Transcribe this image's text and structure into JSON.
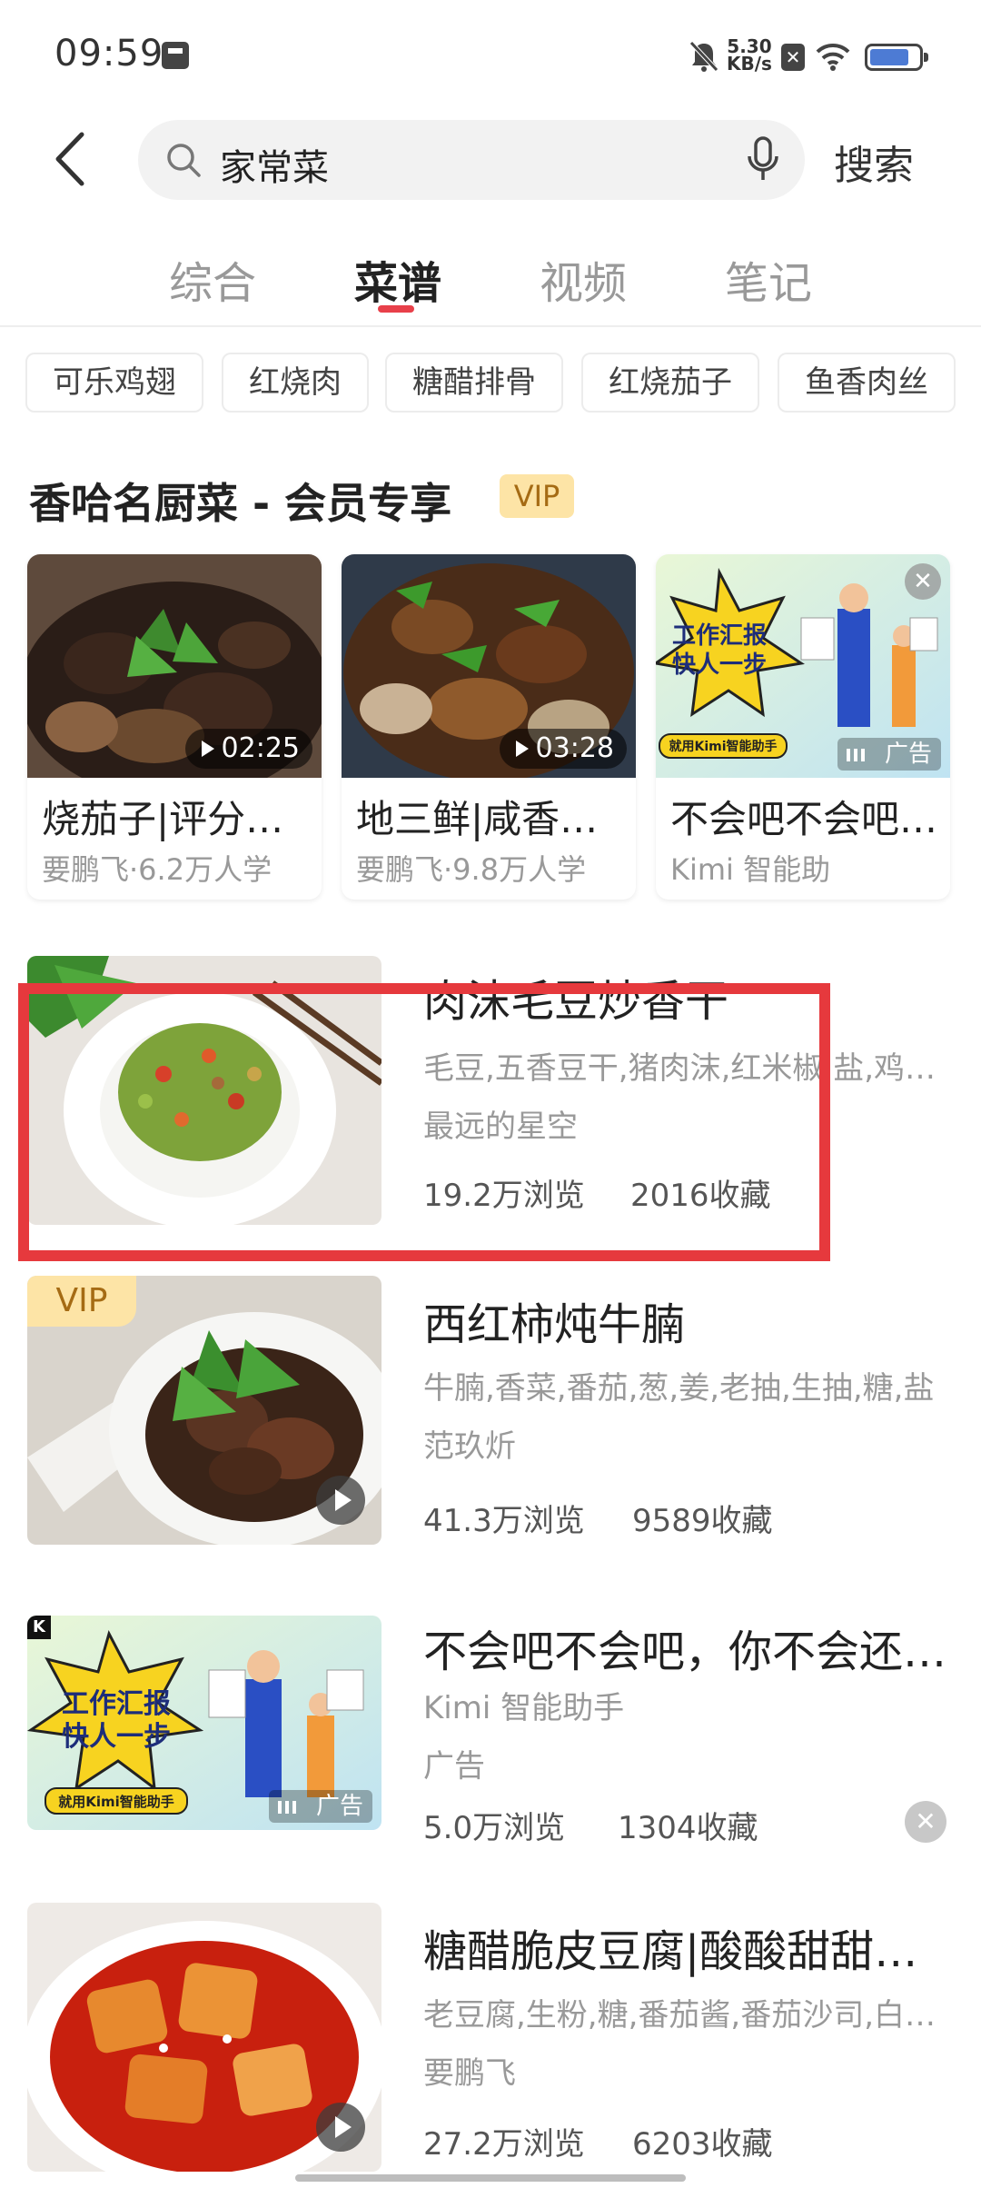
{
  "status_bar": {
    "time": "09:59",
    "net_speed_value": "5.30",
    "net_speed_unit": "KB/s"
  },
  "search": {
    "query": "家常菜",
    "button_label": "搜索"
  },
  "tabs": [
    {
      "label": "综合",
      "active": false
    },
    {
      "label": "菜谱",
      "active": true
    },
    {
      "label": "视频",
      "active": false
    },
    {
      "label": "笔记",
      "active": false
    }
  ],
  "chips": [
    "可乐鸡翅",
    "红烧肉",
    "糖醋排骨",
    "红烧茄子",
    "鱼香肉丝"
  ],
  "section": {
    "title": "香哈名厨菜 - 会员专享",
    "badge": "VIP"
  },
  "cards": [
    {
      "title": "烧茄子|评分最高的做法",
      "subtitle": "要鹏飞·6.2万人学",
      "duration": "02:25",
      "type": "video"
    },
    {
      "title": "地三鲜|咸香下饭",
      "subtitle": "要鹏飞·9.8万人学",
      "duration": "03:28",
      "type": "video"
    },
    {
      "title": "不会吧不会吧，你不会…",
      "subtitle": "Kimi 智能助",
      "ad_label": "广告",
      "ad_art_line1": "工作汇报",
      "ad_art_line2": "快人一步",
      "ad_art_line3": "就用Kimi智能助手",
      "type": "ad"
    }
  ],
  "recipes": [
    {
      "title": "肉沫毛豆炒香干",
      "ingredients": "毛豆,五香豆干,猪肉沫,红米椒,盐,鸡精,生抽",
      "author": "最远的星空",
      "views": "19.2万浏览",
      "favorites": "2016收藏",
      "vip": false,
      "video": false
    },
    {
      "title": "西红柿炖牛腩",
      "ingredients": "牛腩,香菜,番茄,葱,姜,老抽,生抽,糖,盐",
      "author": "范玖炘",
      "views": "41.3万浏览",
      "favorites": "9589收藏",
      "vip": true,
      "vip_label": "VIP",
      "video": true
    },
    {
      "title": "不会吧不会吧，你不会还不知道Kimi吧",
      "ingredients": "Kimi 智能助手",
      "author": "广告",
      "views": "5.0万浏览",
      "favorites": "1304收藏",
      "ad_label": "广告",
      "ad_logo": "K",
      "ad_art_line1": "工作汇报",
      "ad_art_line2": "快人一步",
      "ad_art_line3": "就用Kimi智能助手",
      "is_ad": true
    },
    {
      "title": "糖醋脆皮豆腐|酸酸甜甜超下饭",
      "ingredients": "老豆腐,生粉,糖,番茄酱,番茄沙司,白醋,盐",
      "author": "要鹏飞",
      "views": "27.2万浏览",
      "favorites": "6203收藏",
      "vip": false,
      "video": true
    }
  ],
  "colors": {
    "accent": "#e8404a",
    "vip_bg": "#fde4a6",
    "vip_text": "#a56b14",
    "highlight_border": "#e6393d"
  }
}
